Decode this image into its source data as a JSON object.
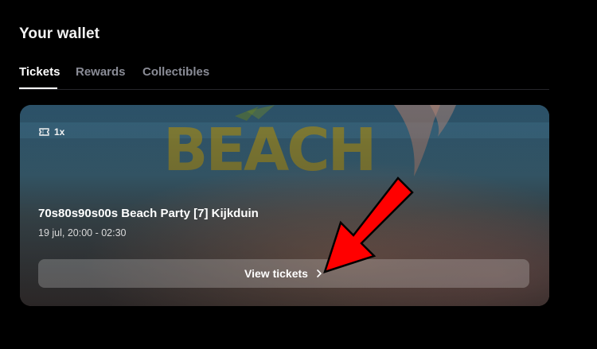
{
  "page": {
    "title": "Your wallet"
  },
  "tabs": [
    {
      "label": "Tickets",
      "active": true
    },
    {
      "label": "Rewards",
      "active": false
    },
    {
      "label": "Collectibles",
      "active": false
    }
  ],
  "ticket_card": {
    "count": "1x",
    "count_icon": "ticket-icon",
    "background_text": "BEACH",
    "event_title": "70s80s90s00s Beach Party [7] Kijkduin",
    "event_date": "19 jul, 20:00 - 02:30",
    "button_label": "View tickets",
    "button_icon": "chevron-right-icon"
  },
  "annotation": {
    "arrow_color": "#ff0000"
  }
}
